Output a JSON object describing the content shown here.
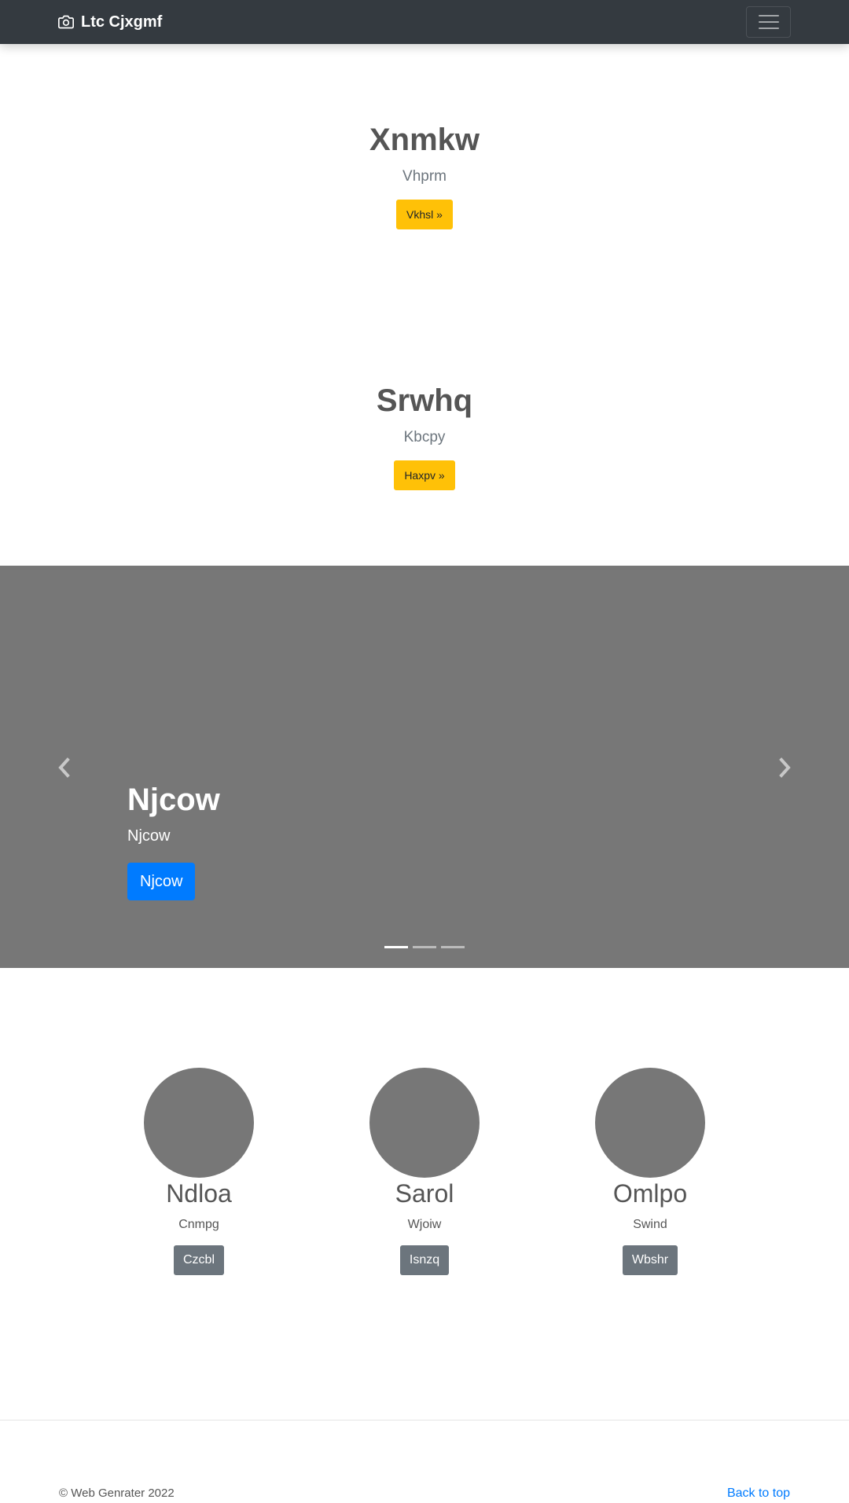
{
  "navbar": {
    "brand": "Ltc Cjxgmf",
    "brand_icon": "camera-icon",
    "toggler_icon": "hamburger-menu-icon"
  },
  "hero1": {
    "title": "Xnmkw",
    "subtitle": "Vhprm",
    "button": "Vkhsl »"
  },
  "hero2": {
    "title": "Srwhq",
    "subtitle": "Kbcpy",
    "button": "Haxpv »"
  },
  "carousel": {
    "title": "Njcow",
    "subtitle": "Njcow",
    "button": "Njcow",
    "prev_icon": "chevron-left-icon",
    "next_icon": "chevron-right-icon",
    "slide_count": 3,
    "active_slide": 1
  },
  "features": [
    {
      "title": "Ndloa",
      "text": "Cnmpg",
      "button": "Czcbl"
    },
    {
      "title": "Sarol",
      "text": "Wjoiw",
      "button": "Isnzq"
    },
    {
      "title": "Omlpo",
      "text": "Swind",
      "button": "Wbshr"
    }
  ],
  "footer": {
    "copyright": "© Web Genrater 2022",
    "back_to_top": "Back to top"
  },
  "colors": {
    "navbar_bg": "#343a40",
    "accent_yellow": "#ffc107",
    "accent_blue": "#007bff",
    "secondary": "#6c757d",
    "placeholder": "#777777"
  }
}
